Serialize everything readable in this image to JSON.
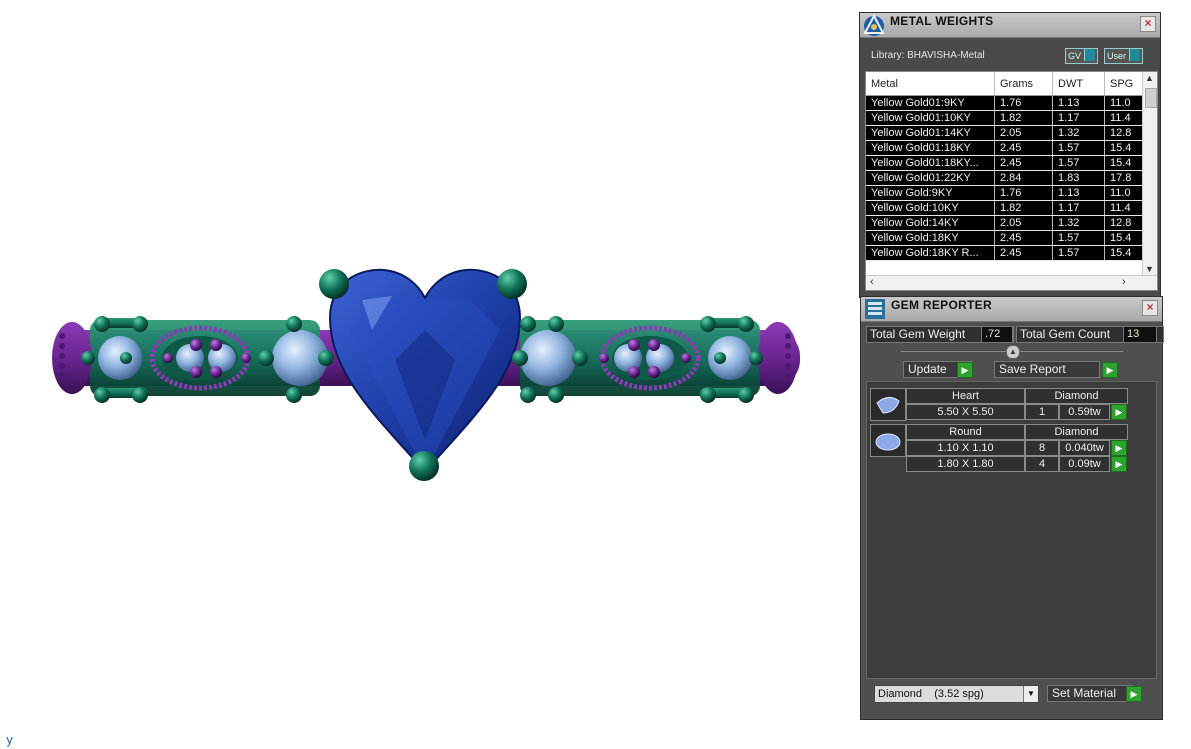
{
  "colors": {
    "metal_green": "#12735a",
    "metal_purple": "#6b2592",
    "gem_blue": "#1e3ea8",
    "gem_light": "#8fb3df",
    "panel_bg": "#4a4a4a",
    "go_green": "#2da42d"
  },
  "viewport": {
    "axis_glyph": "y"
  },
  "metal_panel": {
    "title": "METAL WEIGHTS",
    "close_label": "×",
    "logo_icon": "gold-triangle-logo-icon",
    "library_label": "Library: BHAVISHA-Metal",
    "toggle_gv": "GV",
    "toggle_user": "User",
    "columns": [
      "Metal",
      "Grams",
      "DWT",
      "SPG"
    ],
    "rows": [
      [
        "Yellow Gold01:9KY",
        "1.76",
        "1.13",
        "11.0"
      ],
      [
        "Yellow Gold01:10KY",
        "1.82",
        "1.17",
        "11.4"
      ],
      [
        "Yellow Gold01:14KY",
        "2.05",
        "1.32",
        "12.8"
      ],
      [
        "Yellow Gold01:18KY",
        "2.45",
        "1.57",
        "15.4"
      ],
      [
        "Yellow Gold01:18KY...",
        "2.45",
        "1.57",
        "15.4"
      ],
      [
        "Yellow Gold01:22KY",
        "2.84",
        "1.83",
        "17.8"
      ],
      [
        "Yellow Gold:9KY",
        "1.76",
        "1.13",
        "11.0"
      ],
      [
        "Yellow Gold:10KY",
        "1.82",
        "1.17",
        "11.4"
      ],
      [
        "Yellow Gold:14KY",
        "2.05",
        "1.32",
        "12.8"
      ],
      [
        "Yellow Gold:18KY",
        "2.45",
        "1.57",
        "15.4"
      ],
      [
        "Yellow Gold:18KY R...",
        "2.45",
        "1.57",
        "15.4"
      ]
    ]
  },
  "gem_panel": {
    "title": "GEM REPORTER",
    "close_label": "×",
    "logo_icon": "gem-report-logo-icon",
    "total_weight_label": "Total Gem Weight",
    "total_weight_value": ".72",
    "total_count_label": "Total Gem Count",
    "total_count_value": "13",
    "update_label": "Update",
    "save_report_label": "Save Report",
    "groups": [
      {
        "shape": "Heart",
        "material": "Diamond",
        "rows": [
          {
            "size": "5.50 X 5.50",
            "count": "1",
            "weight": "0.59tw"
          }
        ]
      },
      {
        "shape": "Round",
        "material": "Diamond",
        "rows": [
          {
            "size": "1.10 X 1.10",
            "count": "8",
            "weight": "0.040tw"
          },
          {
            "size": "1.80 X 1.80",
            "count": "4",
            "weight": "0.09tw"
          }
        ]
      }
    ],
    "material_select": "Diamond    (3.52 spg)",
    "set_material_label": "Set Material"
  }
}
